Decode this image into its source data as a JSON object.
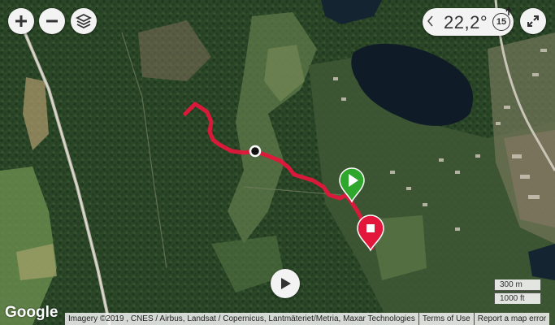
{
  "map": {
    "controls": {
      "zoom_in": "plus-icon",
      "zoom_out": "minus-icon",
      "layers": "layers-icon",
      "fullscreen": "expand-icon"
    },
    "weather": {
      "temperature": "22,2°",
      "wind_speed": "15",
      "icon": "compass-arrow-icon"
    },
    "route": {
      "color": "#e3173b",
      "start_marker_color": "#2fa62c",
      "end_marker_color": "#e3173b",
      "position_marker": "position-dot-icon"
    },
    "playback": {
      "icon": "play-icon"
    },
    "scale": {
      "metric": "300 m",
      "imperial": "1000 ft"
    },
    "logo": "Google",
    "attribution": {
      "imagery": "Imagery ©2019 , CNES / Airbus, Landsat / Copernicus, Lantmäteriet/Metria, Maxar Technologies",
      "terms": "Terms of Use",
      "report": "Report a map error"
    }
  }
}
